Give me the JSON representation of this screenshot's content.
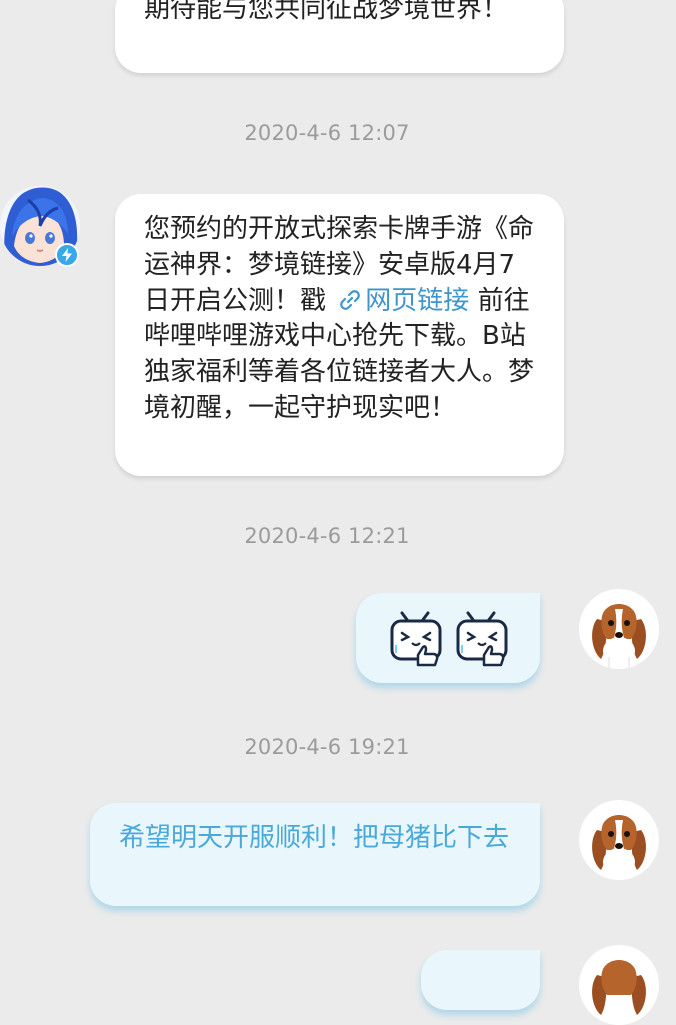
{
  "messages": [
    {
      "type": "text",
      "side": "left",
      "text": "期待能与您共同征战梦境世界！"
    },
    {
      "type": "time",
      "text": "2020-4-6 12:07"
    },
    {
      "type": "text",
      "side": "left",
      "text_before": "您预约的开放式探索卡牌手游《命运神界：梦境链接》安卓版4月7日开启公测！戳",
      "link_label": "网页链接",
      "text_after": "前往哔哩哔哩游戏中心抢先下载。B站独家福利等着各位链接者大人。梦境初醒，一起守护现实吧！",
      "sender": "official-account",
      "verified": true
    },
    {
      "type": "time",
      "text": "2020-4-6 12:21"
    },
    {
      "type": "emoji",
      "side": "right",
      "emojis": [
        "bilibili-tv-thumbs-up",
        "bilibili-tv-thumbs-up"
      ]
    },
    {
      "type": "time",
      "text": "2020-4-6 19:21"
    },
    {
      "type": "text",
      "side": "right",
      "text": "希望明天开服顺利！把母猪比下去"
    }
  ],
  "colors": {
    "background": "#ebebeb",
    "incoming_bubble": "#ffffff",
    "outgoing_bubble": "#e9f7fd",
    "outgoing_text": "#49a9d9",
    "link": "#3f95cc",
    "verified_badge": "#38a8e8",
    "timestamp": "#9b9b9b"
  }
}
